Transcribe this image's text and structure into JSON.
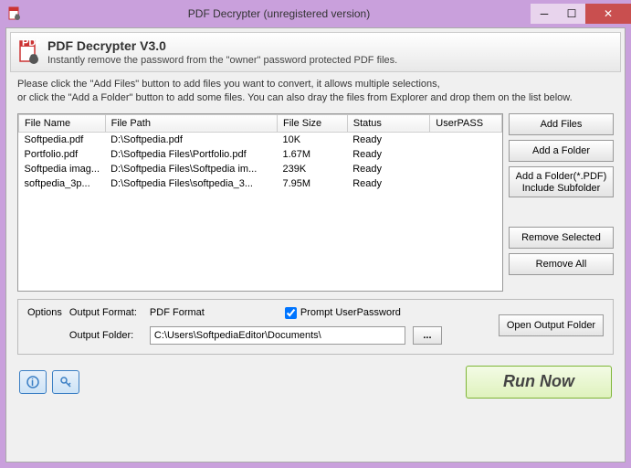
{
  "window": {
    "title": "PDF Decrypter (unregistered version)"
  },
  "header": {
    "title": "PDF Decrypter V3.0",
    "subtitle": "Instantly remove the password from  the \"owner\" password protected PDF files."
  },
  "instruction": {
    "line1": "Please click the \"Add Files\" button to add files you want to convert, it allows multiple selections,",
    "line2": "or click the \"Add a Folder\" button to add some files. You can also dray the files from Explorer and drop them on the list below."
  },
  "columns": {
    "name": "File Name",
    "path": "File Path",
    "size": "File Size",
    "status": "Status",
    "upass": "UserPASS"
  },
  "rows": [
    {
      "name": "Softpedia.pdf",
      "path": "D:\\Softpedia.pdf",
      "size": "10K",
      "status": "Ready",
      "upass": ""
    },
    {
      "name": "Portfolio.pdf",
      "path": "D:\\Softpedia Files\\Portfolio.pdf",
      "size": "1.67M",
      "status": "Ready",
      "upass": ""
    },
    {
      "name": "Softpedia imag...",
      "path": "D:\\Softpedia Files\\Softpedia im...",
      "size": "239K",
      "status": "Ready",
      "upass": ""
    },
    {
      "name": "softpedia_3p...",
      "path": "D:\\Softpedia Files\\softpedia_3...",
      "size": "7.95M",
      "status": "Ready",
      "upass": ""
    }
  ],
  "buttons": {
    "add_files": "Add Files",
    "add_folder": "Add a Folder",
    "add_folder_sub": "Add a Folder(*.PDF)\nInclude Subfolder",
    "remove_selected": "Remove Selected",
    "remove_all": "Remove All",
    "open_output": "Open Output Folder",
    "run": "Run Now",
    "browse": "..."
  },
  "options": {
    "legend": "Options",
    "format_label": "Output Format:",
    "format_value": "PDF Format",
    "prompt_label": "Prompt UserPassword",
    "folder_label": "Output Folder:",
    "folder_value": "C:\\Users\\SoftpediaEditor\\Documents\\"
  }
}
